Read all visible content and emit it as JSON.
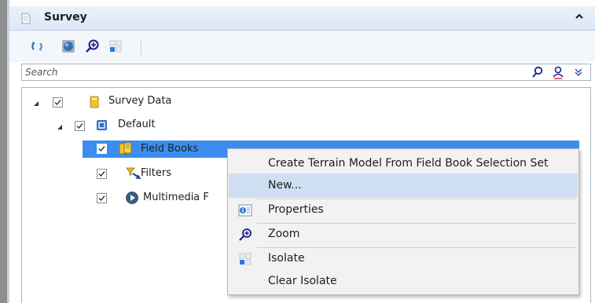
{
  "panel": {
    "title": "Survey"
  },
  "toolbar": {
    "buttons": [
      {
        "name": "refresh-icon"
      },
      {
        "name": "globe-icon"
      },
      {
        "name": "zoom-icon"
      },
      {
        "name": "isolate-icon"
      }
    ]
  },
  "search": {
    "placeholder": "Search",
    "value": ""
  },
  "tree": {
    "root": {
      "label": "Survey Data",
      "checked": true,
      "expanded": true
    },
    "default": {
      "label": "Default",
      "checked": true,
      "expanded": true
    },
    "items": [
      {
        "label": "Field Books",
        "checked": true,
        "selected": true,
        "icon": "field-book-icon"
      },
      {
        "label": "Filters",
        "checked": true,
        "icon": "filter-icon"
      },
      {
        "label": "Multimedia F",
        "checked": true,
        "icon": "multimedia-icon"
      }
    ]
  },
  "context_menu": {
    "items": [
      {
        "label": "Create Terrain Model From Field Book Selection Set",
        "icon": ""
      },
      {
        "label": "New...",
        "icon": "",
        "highlighted": true
      },
      {
        "label": "Properties",
        "icon": "properties-icon"
      },
      {
        "label": "Zoom",
        "icon": "zoom-icon"
      },
      {
        "label": "Isolate",
        "icon": "isolate-icon"
      },
      {
        "label": "Clear Isolate",
        "icon": ""
      }
    ]
  },
  "colors": {
    "selection": "#3b8ef0",
    "menu_highlight": "#cfdff2",
    "header_bg": "#dde7f5"
  }
}
